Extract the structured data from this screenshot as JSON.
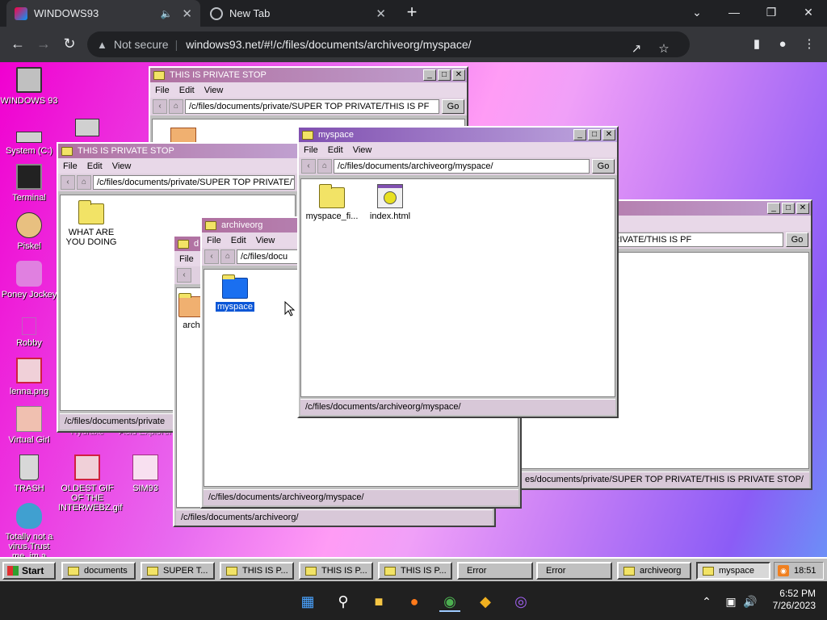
{
  "browser": {
    "active_tab": {
      "title": "WINDOWS93"
    },
    "inactive_tab": {
      "title": "New Tab"
    },
    "security_label": "Not secure",
    "url": "windows93.net/#!/c/files/documents/archiveorg/myspace/"
  },
  "desktop_icons": [
    {
      "label": "WINDOWS 93",
      "icon": "computer-icon"
    },
    {
      "label": "System (C:)",
      "icon": "drive-icon"
    },
    {
      "label": "Terminal",
      "icon": "terminal-icon"
    },
    {
      "label": "Piskel",
      "icon": "palette-icon"
    },
    {
      "label": "Poney Jockey",
      "icon": "pony-icon"
    },
    {
      "label": "Robby",
      "icon": "robot-icon"
    },
    {
      "label": "lenna.png",
      "icon": "image-icon"
    },
    {
      "label": "Virtual Girl",
      "icon": "face-icon"
    },
    {
      "label": "TRASH",
      "icon": "trash-icon"
    },
    {
      "label": "OLDEST GIF OF THE INTERWEBZ.gif",
      "icon": "gif-icon"
    },
    {
      "label": "SIM93",
      "icon": "sim-icon"
    },
    {
      "label": "Totally not a virus.Trust me..im a",
      "icon": "dolphin-icon"
    },
    {
      "label": "Hydraxe",
      "icon": "app-icon"
    },
    {
      "label": "Acid Explorer",
      "icon": "app-icon"
    }
  ],
  "windows": {
    "private_back": {
      "title": "THIS IS PRIVATE STOP",
      "menu": [
        "File",
        "Edit",
        "View"
      ],
      "path": "/c/files/documents/private/SUPER TOP PRIVATE/THIS IS PF",
      "go": "Go"
    },
    "private_left": {
      "title": "THIS IS PRIVATE STOP",
      "menu": [
        "File",
        "Edit",
        "View"
      ],
      "path": "/c/files/documents/private/SUPER TOP PRIVATE/THIS IS PRIVATE STOP/",
      "item": "WHAT ARE YOU DOING",
      "status": "/c/files/documents/private"
    },
    "private_right": {
      "path": "private/SUPER TOP PRIVATE/THIS IS PF",
      "go": "Go",
      "status": "es/documents/private/SUPER TOP PRIVATE/THIS IS PRIVATE STOP/"
    },
    "documents": {
      "title_partial": "d",
      "menu": [
        "File"
      ],
      "item_partial": "arch",
      "status": "/c/files/documents/archiveorg/"
    },
    "archiveorg": {
      "title": "archiveorg",
      "menu": [
        "File",
        "Edit",
        "View"
      ],
      "path": "/c/files/docu",
      "item": "myspace",
      "status": "/c/files/documents/archiveorg/myspace/"
    },
    "myspace": {
      "title": "myspace",
      "menu": [
        "File",
        "Edit",
        "View"
      ],
      "path": "/c/files/documents/archiveorg/myspace/",
      "go": "Go",
      "items": [
        "myspace_fi...",
        "index.html"
      ],
      "status": "/c/files/documents/archiveorg/myspace/"
    }
  },
  "taskbar": {
    "start": "Start",
    "tasks": [
      "documents",
      "SUPER T...",
      "THIS IS P...",
      "THIS IS P...",
      "THIS IS P...",
      "Error",
      "Error",
      "archiveorg",
      "myspace"
    ],
    "tray_time": "18:51"
  },
  "os_taskbar": {
    "time": "6:52 PM",
    "date": "7/26/2023"
  },
  "colors": {
    "titlebar_active": "#8050b0",
    "folder": "#f2e366",
    "selected": "#0a56d6"
  }
}
